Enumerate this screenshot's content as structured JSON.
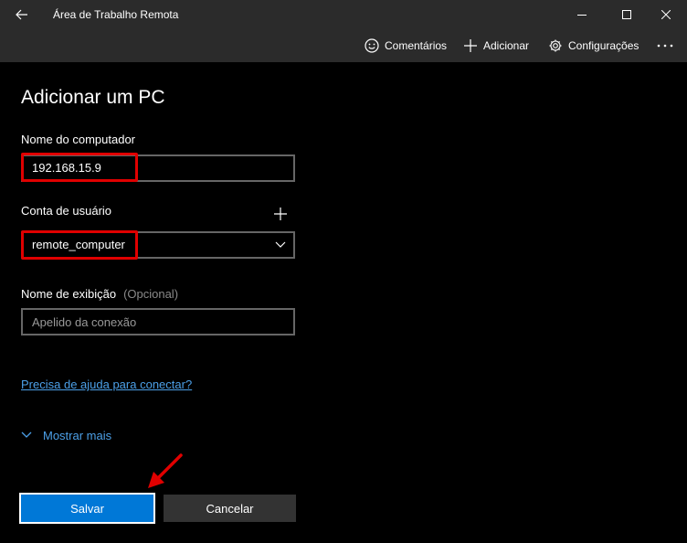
{
  "window": {
    "title": "Área de Trabalho Remota",
    "back_icon": "arrow-left-icon",
    "controls": [
      "minimize-icon",
      "maximize-icon",
      "close-icon"
    ]
  },
  "commandbar": {
    "feedback_label": "Comentários",
    "add_label": "Adicionar",
    "settings_label": "Configurações",
    "more_icon": "ellipsis-icon"
  },
  "form": {
    "title": "Adicionar um PC",
    "computer_name": {
      "label": "Nome do computador",
      "value": "192.168.15.9"
    },
    "user_account": {
      "label": "Conta de usuário",
      "selected": "remote_computer",
      "add_icon": "plus-icon"
    },
    "display_name": {
      "label": "Nome de exibição",
      "optional": "(Opcional)",
      "placeholder": "Apelido da conexão"
    },
    "help_link": "Precisa de ajuda para conectar?",
    "show_more": "Mostrar mais"
  },
  "buttons": {
    "save": "Salvar",
    "cancel": "Cancelar"
  },
  "colors": {
    "accent": "#0078d7",
    "link": "#4ca0e8",
    "highlight": "#e00000",
    "chrome": "#2b2b2b"
  }
}
